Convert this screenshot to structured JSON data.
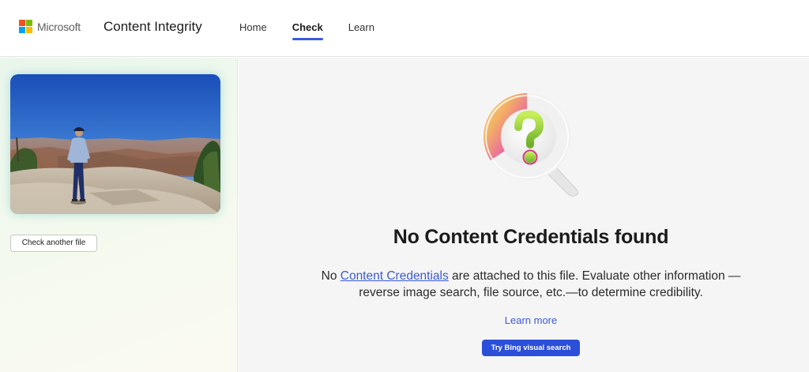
{
  "header": {
    "brand": "Microsoft",
    "product": "Content Integrity",
    "logo_colors": [
      "#f25022",
      "#7fba00",
      "#00a4ef",
      "#ffb900"
    ],
    "nav": [
      {
        "label": "Home",
        "active": false
      },
      {
        "label": "Check",
        "active": true
      },
      {
        "label": "Learn",
        "active": false
      }
    ]
  },
  "sidebar": {
    "check_another_label": "Check another file"
  },
  "main": {
    "icon": "magnifier-question-icon",
    "title": "No Content Credentials found",
    "desc_prefix": "No ",
    "desc_link": "Content Credentials",
    "desc_suffix": " are attached to this file. Evaluate other information —reverse image search, file source, etc.—to determine credibility.",
    "learn_more": "Learn more",
    "bing_button": "Try Bing visual search"
  },
  "colors": {
    "accent": "#3b5bdb",
    "button_primary": "#2b4fd9"
  }
}
